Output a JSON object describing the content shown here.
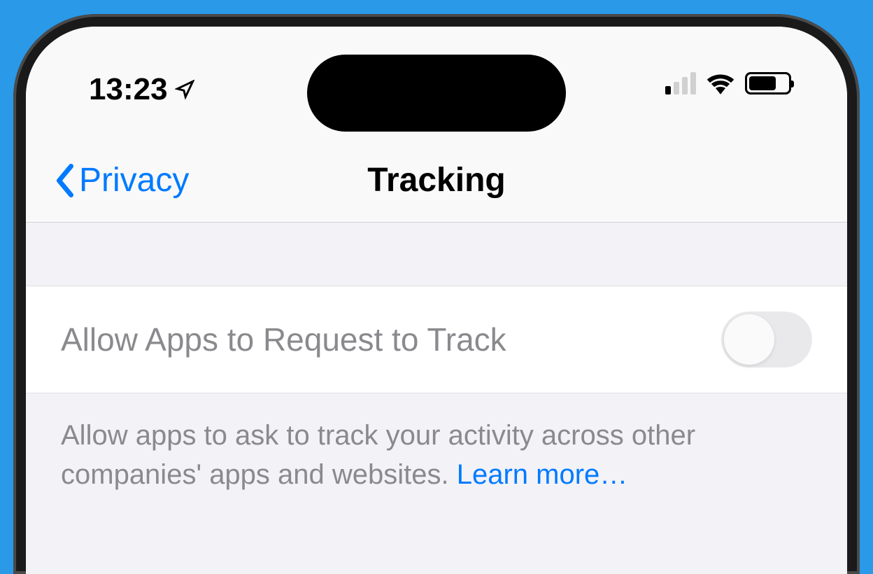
{
  "statusBar": {
    "time": "13:23"
  },
  "navBar": {
    "backLabel": "Privacy",
    "title": "Tracking"
  },
  "setting": {
    "label": "Allow Apps to Request to Track",
    "enabled": false
  },
  "footer": {
    "text": "Allow apps to ask to track your activity across other companies' apps and websites. ",
    "linkText": "Learn more…"
  }
}
